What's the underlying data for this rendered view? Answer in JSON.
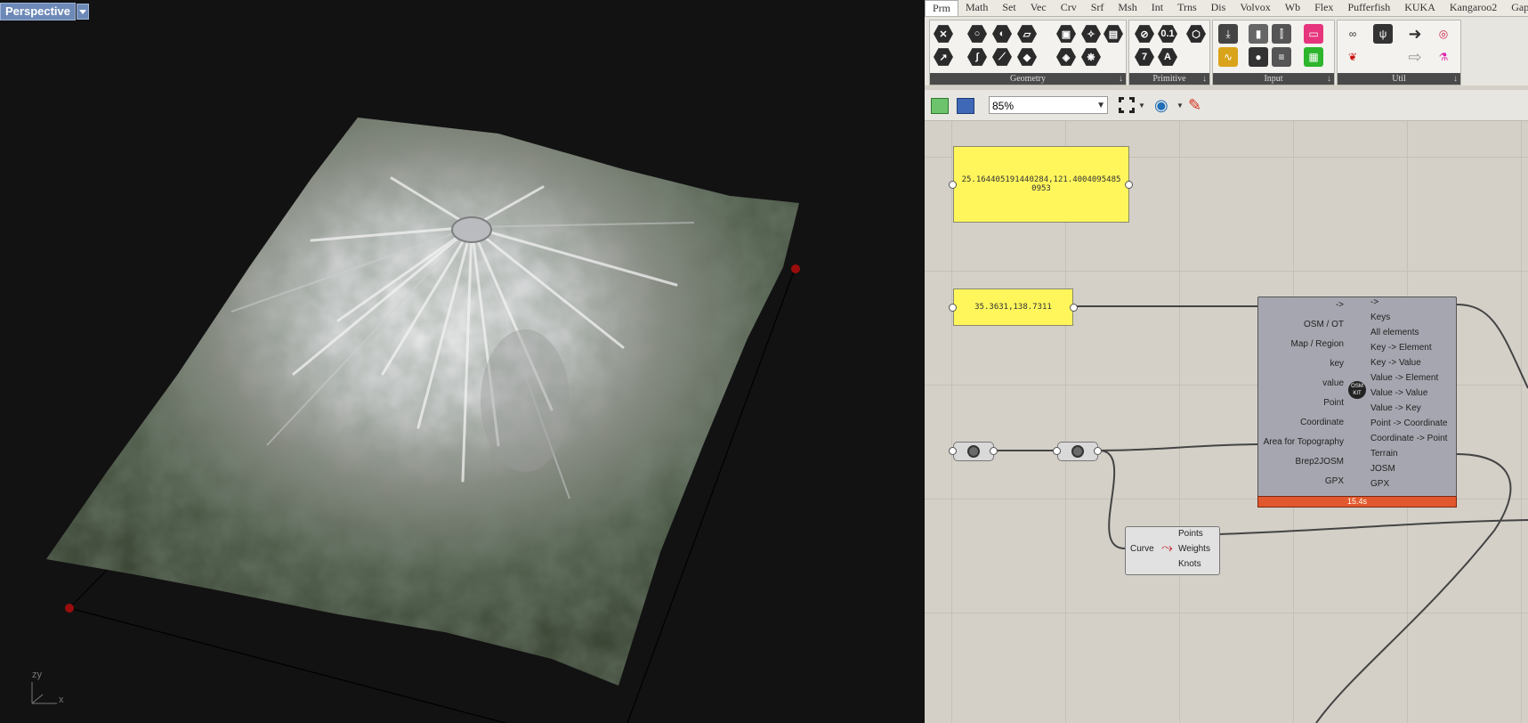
{
  "viewport": {
    "title": "Perspective",
    "axis_labels": {
      "zy": "zy",
      "x": "x"
    }
  },
  "tabs": [
    "Prm",
    "Math",
    "Set",
    "Vec",
    "Crv",
    "Srf",
    "Msh",
    "Int",
    "Trns",
    "Dis",
    "Volvox",
    "Wb",
    "Flex",
    "Pufferfish",
    "KUKA",
    "Kangaroo2",
    "Gap"
  ],
  "ribbon": {
    "groups": [
      {
        "label": "Geometry"
      },
      {
        "label": "Primitive"
      },
      {
        "label": "Input"
      },
      {
        "label": "Util"
      }
    ],
    "pin": "↓",
    "primitive_icons": [
      "0.1",
      "7",
      "A"
    ]
  },
  "toolbar": {
    "zoom": "85%"
  },
  "canvas": {
    "panel1_text": "25.164405191440284,121.4004095485 0953",
    "panel2_text": "35.3631,138.7311",
    "osm_component": {
      "inputs": [
        "->",
        "OSM / OT",
        "Map / Region",
        "key",
        "value",
        "Point",
        "Coordinate",
        "Area for Topography",
        "Brep2JOSM",
        "GPX"
      ],
      "outputs": [
        "->",
        "Keys",
        "All elements",
        "Key -> Element",
        "Key -> Value",
        "Value -> Element",
        "Value -> Value",
        "Value -> Key",
        "Point -> Coordinate",
        "Coordinate -> Point",
        "Terrain",
        "JOSM",
        "GPX"
      ],
      "timer": "15.4s",
      "badge": "OSM KIT"
    },
    "curve_component": {
      "input": "Curve",
      "outputs": [
        "Points",
        "Weights",
        "Knots"
      ]
    }
  },
  "colors": {
    "panel_yellow": "#fff65c",
    "timer_orange": "#e2582e",
    "viewport_bg": "#121212"
  }
}
